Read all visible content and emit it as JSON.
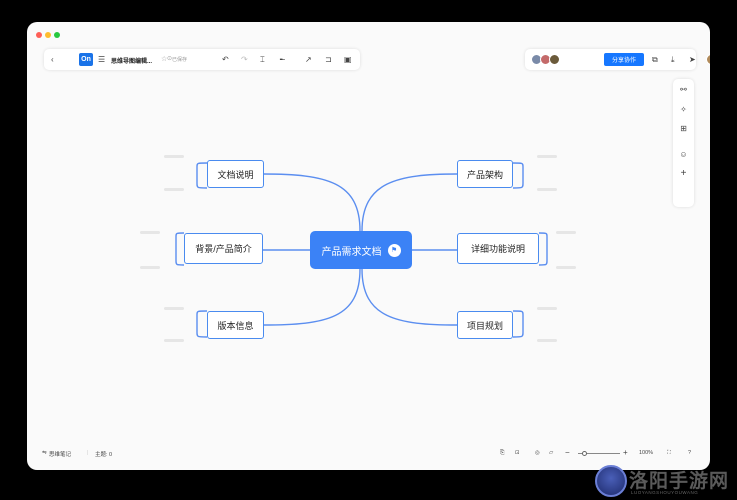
{
  "colors": {
    "accent": "#3b82f6",
    "node_border": "#4a8bef",
    "line": "#5b8ef0",
    "share_button": "#1677ff",
    "dot_red": "#fe5f57",
    "dot_yellow": "#febc2e",
    "dot_green": "#28c840"
  },
  "toolbar": {
    "back_icon": "chevron-left-icon",
    "logo": "On",
    "menu_icon": "hamburger-icon",
    "doc_title": "思维导图编辑...",
    "star_icon": "star-icon",
    "saved_text": "已保存",
    "undo_icon": "undo-icon",
    "redo_icon": "redo-icon",
    "format_painter_icon": "format-painter-icon",
    "connector_icon": "connector-icon",
    "arrow_icon": "arrow-icon",
    "outline_icon": "outline-icon",
    "frame_icon": "frame-icon"
  },
  "toolbar_right": {
    "share_label": "分享协作",
    "present_icon": "present-icon",
    "download_icon": "download-icon",
    "send_icon": "send-icon"
  },
  "side_tools": [
    "settings-icon",
    "magic-icon",
    "structure-icon",
    "emoji-icon",
    "plus-icon"
  ],
  "mindmap": {
    "central": "产品需求文档",
    "left_nodes": [
      "文档说明",
      "背景/产品简介",
      "版本信息"
    ],
    "right_nodes": [
      "产品架构",
      "详细功能说明",
      "项目规划"
    ]
  },
  "statusbar": {
    "notes_label": "思维笔记",
    "topic_label": "主题: 0",
    "zoom_label": "100%"
  },
  "watermark": {
    "text": "洛阳手游网",
    "sub": "LUOYANGSHOUYOUWANG"
  }
}
